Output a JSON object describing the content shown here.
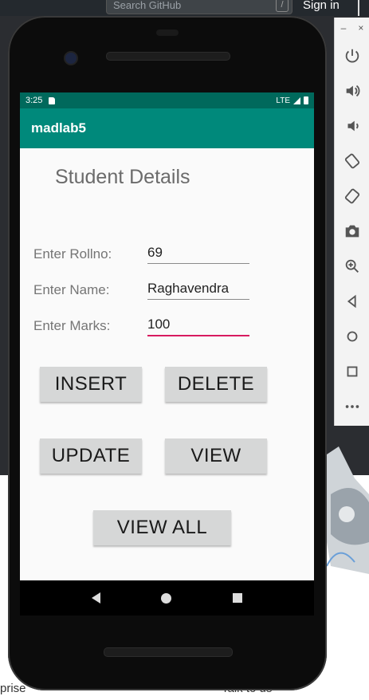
{
  "background": {
    "search_placeholder": "Search GitHub",
    "search_shortcut": "/",
    "signin": "Sign in",
    "text_left": "prise",
    "text_right": "Talk to us"
  },
  "emulator_panel": {
    "window_controls": [
      "–",
      "×"
    ],
    "buttons": [
      "power-icon",
      "volume-up-icon",
      "volume-down-icon",
      "rotate-left-icon",
      "rotate-right-icon",
      "camera-icon",
      "zoom-icon",
      "back-icon",
      "home-icon",
      "overview-icon",
      "more-icon"
    ]
  },
  "status_bar": {
    "time": "3:25",
    "network": "LTE"
  },
  "app_bar": {
    "title": "madlab5"
  },
  "form": {
    "title": "Student Details",
    "rollno_label": "Enter Rollno:",
    "rollno_value": "69",
    "name_label": "Enter Name:",
    "name_value": "Raghavendra",
    "marks_label": "Enter Marks:",
    "marks_value": "100"
  },
  "buttons": {
    "insert": "INSERT",
    "delete": "DELETE",
    "update": "UPDATE",
    "view": "VIEW",
    "view_all": "VIEW ALL"
  },
  "colors": {
    "status_bar": "#00695c",
    "app_bar": "#00897b",
    "accent": "#d81b60"
  }
}
